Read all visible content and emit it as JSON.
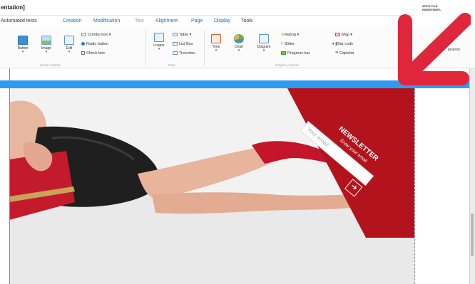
{
  "window": {
    "title": "entation]",
    "right_label": "ATELITYLE\nRIGENTMMTL"
  },
  "tabs": [
    {
      "label": "Automated tests",
      "state": "first"
    },
    {
      "label": "Creation",
      "state": "selected"
    },
    {
      "label": "Modification",
      "state": "normal"
    },
    {
      "label": "Text",
      "state": "dim"
    },
    {
      "label": "Alignment",
      "state": "normal"
    },
    {
      "label": "Page",
      "state": "normal"
    },
    {
      "label": "Display",
      "state": "normal"
    },
    {
      "label": "Tools",
      "state": "first"
    }
  ],
  "ribbon": {
    "buttons": [
      {
        "label": "Button",
        "icon": "button-icon"
      },
      {
        "label": "Image",
        "icon": "image-icon"
      },
      {
        "label": "Edit",
        "icon": "edit-icon"
      },
      {
        "label": "Looper",
        "icon": "looper-icon"
      },
      {
        "label": "Time",
        "icon": "time-icon"
      },
      {
        "label": "Chart",
        "icon": "chart-icon"
      },
      {
        "label": "Diagram",
        "icon": "diagram-icon"
      }
    ],
    "controls_list": [
      "Combo box",
      "Radio button",
      "Check box"
    ],
    "data_list": [
      "Table",
      "List Box",
      "Treeview"
    ],
    "graphic_list": [
      "Rating",
      "Slider",
      "Progress bar"
    ],
    "other_list": [
      "Map",
      "Bar code",
      "Captcha"
    ],
    "group_labels": [
      "Usual controls",
      "Data",
      "Graphic controls"
    ],
    "right_text": "pration"
  },
  "colors": {
    "ribbon_blue": "#2f9bf0",
    "brand_red": "#b3131d",
    "arrow_red": "#e0263a",
    "selection_pink": "#d8a1aa"
  },
  "newsletter": {
    "title": "NEWSLETTER",
    "subtitle": "Enter your email",
    "placeholder": "Your email",
    "submit_icon": "arrow-right-icon"
  }
}
